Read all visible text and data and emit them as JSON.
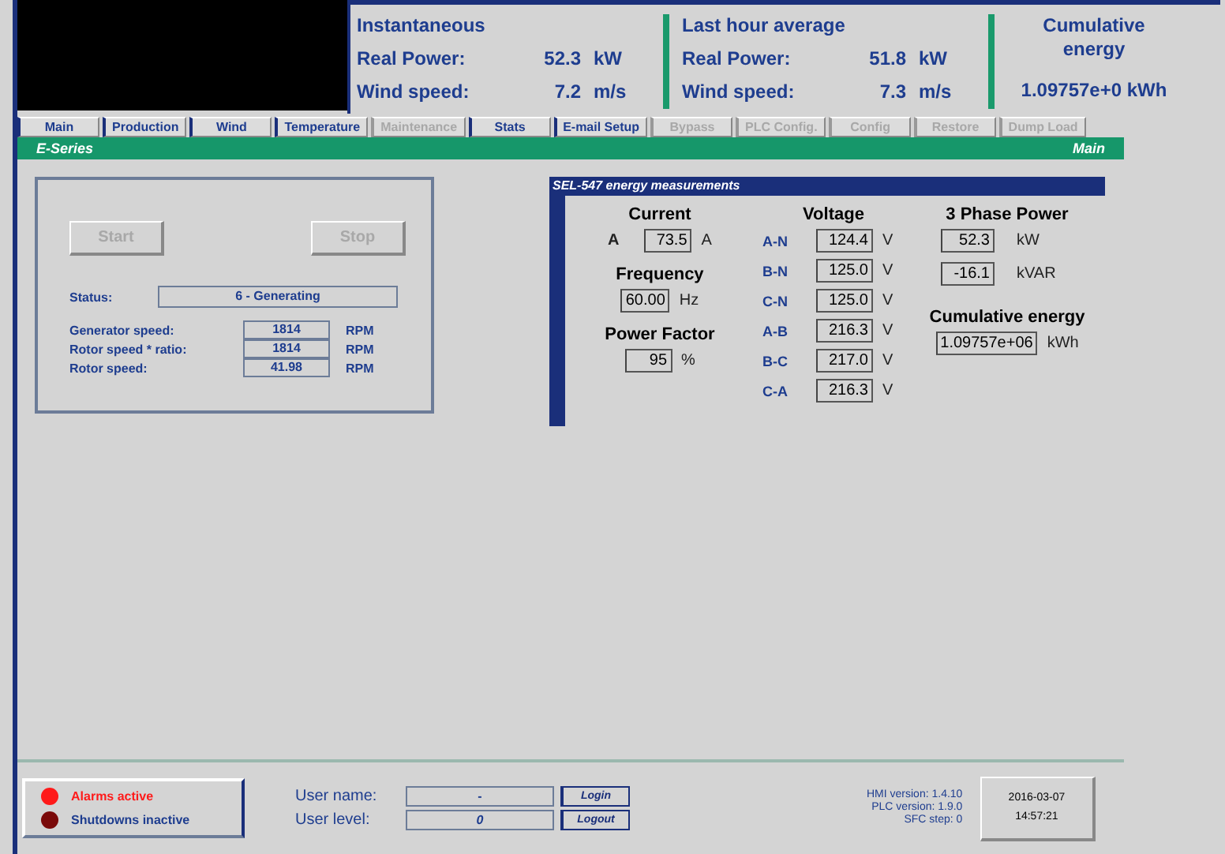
{
  "header": {
    "instantaneous": {
      "title": "Instantaneous",
      "rows": [
        {
          "label": "Real Power:",
          "value": "52.3",
          "unit": "kW"
        },
        {
          "label": "Wind speed:",
          "value": "7.2",
          "unit": "m/s"
        }
      ]
    },
    "last_hour": {
      "title": "Last hour average",
      "rows": [
        {
          "label": "Real Power:",
          "value": "51.8",
          "unit": "kW"
        },
        {
          "label": "Wind speed:",
          "value": "7.3",
          "unit": "m/s"
        }
      ]
    },
    "cumulative": {
      "title": "Cumulative energy",
      "value": "1.09757e+0 kWh"
    }
  },
  "tabs": [
    {
      "label": "Main",
      "disabled": false
    },
    {
      "label": "Production",
      "disabled": false
    },
    {
      "label": "Wind",
      "disabled": false
    },
    {
      "label": "Temperature",
      "disabled": false
    },
    {
      "label": "Maintenance",
      "disabled": true
    },
    {
      "label": "Stats",
      "disabled": false
    },
    {
      "label": "E-mail Setup",
      "disabled": false
    },
    {
      "label": "Bypass",
      "disabled": true
    },
    {
      "label": "PLC Config.",
      "disabled": true
    },
    {
      "label": "Config",
      "disabled": true
    },
    {
      "label": "Restore",
      "disabled": true
    },
    {
      "label": "Dump Load",
      "disabled": true
    }
  ],
  "banner": {
    "left": "E-Series",
    "right": "Main"
  },
  "control": {
    "buttons": [
      {
        "label": "Start",
        "disabled": true
      },
      {
        "label": "Stop",
        "disabled": true
      }
    ],
    "status": {
      "label": "Status:",
      "value": "6 - Generating"
    },
    "speeds": [
      {
        "label": "Generator speed:",
        "value": "1814",
        "unit": "RPM"
      },
      {
        "label": "Rotor speed * ratio:",
        "value": "1814",
        "unit": "RPM"
      },
      {
        "label": "Rotor speed:",
        "value": "41.98",
        "unit": "RPM"
      }
    ]
  },
  "energy": {
    "title": "SEL-547 energy measurements",
    "current": {
      "title": "Current",
      "prefix": "A",
      "value": "73.5",
      "unit": "A"
    },
    "frequency": {
      "title": "Frequency",
      "value": "60.00",
      "unit": "Hz"
    },
    "power_factor": {
      "title": "Power Factor",
      "value": "95",
      "unit": "%"
    },
    "voltage": {
      "title": "Voltage",
      "rows": [
        {
          "label": "A-N",
          "value": "124.4",
          "unit": "V"
        },
        {
          "label": "B-N",
          "value": "125.0",
          "unit": "V"
        },
        {
          "label": "C-N",
          "value": "125.0",
          "unit": "V"
        },
        {
          "label": "A-B",
          "value": "216.3",
          "unit": "V"
        },
        {
          "label": "B-C",
          "value": "217.0",
          "unit": "V"
        },
        {
          "label": "C-A",
          "value": "216.3",
          "unit": "V"
        }
      ]
    },
    "three_phase": {
      "title": "3 Phase Power",
      "rows": [
        {
          "value": "52.3",
          "unit": "kW"
        },
        {
          "value": "-16.1",
          "unit": "kVAR"
        }
      ]
    },
    "cumulative": {
      "title": "Cumulative energy",
      "value": "1.09757e+06",
      "unit": "kWh"
    }
  },
  "alarms": [
    {
      "label": "Alarms active",
      "color": "#ff1a1a"
    },
    {
      "label": "Shutdowns inactive",
      "color": "#7a0a0a"
    }
  ],
  "user": {
    "name_label": "User name:",
    "name": "-",
    "level_label": "User level:",
    "level": "0",
    "login": "Login",
    "logout": "Logout"
  },
  "versions": [
    "HMI version: 1.4.10",
    "PLC version: 1.9.0",
    "SFC step: 0"
  ],
  "datetime": {
    "date": "2016-03-07",
    "time": "14:57:21"
  }
}
